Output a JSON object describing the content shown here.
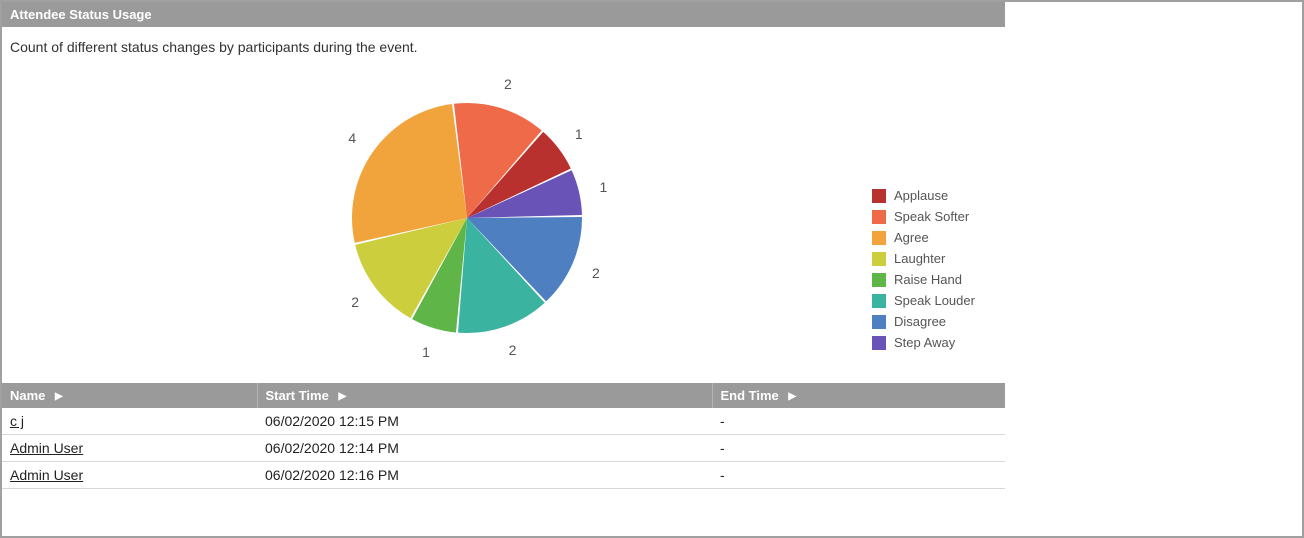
{
  "panel": {
    "title": "Attendee Status Usage",
    "description": "Count of different status changes by participants during the event."
  },
  "chart_data": {
    "type": "pie",
    "title": "",
    "series": [
      {
        "name": "Applause",
        "value": 1,
        "color": "#b8312f"
      },
      {
        "name": "Speak Softer",
        "value": 2,
        "color": "#ef6a48"
      },
      {
        "name": "Agree",
        "value": 4,
        "color": "#f2a43c"
      },
      {
        "name": "Laughter",
        "value": 2,
        "color": "#cdce3e"
      },
      {
        "name": "Raise Hand",
        "value": 1,
        "color": "#5fb548"
      },
      {
        "name": "Speak Louder",
        "value": 2,
        "color": "#3bb3a1"
      },
      {
        "name": "Disagree",
        "value": 2,
        "color": "#4e7fc0"
      },
      {
        "name": "Step Away",
        "value": 1,
        "color": "#6a53b6"
      }
    ],
    "legend_position": "right"
  },
  "table": {
    "columns": [
      "Name",
      "Start Time",
      "End Time"
    ],
    "rows": [
      {
        "name": "c j",
        "start": "06/02/2020 12:15 PM",
        "end": "-"
      },
      {
        "name": "Admin User",
        "start": "06/02/2020 12:14 PM",
        "end": "-"
      },
      {
        "name": "Admin User",
        "start": "06/02/2020 12:16 PM",
        "end": "-"
      }
    ]
  }
}
